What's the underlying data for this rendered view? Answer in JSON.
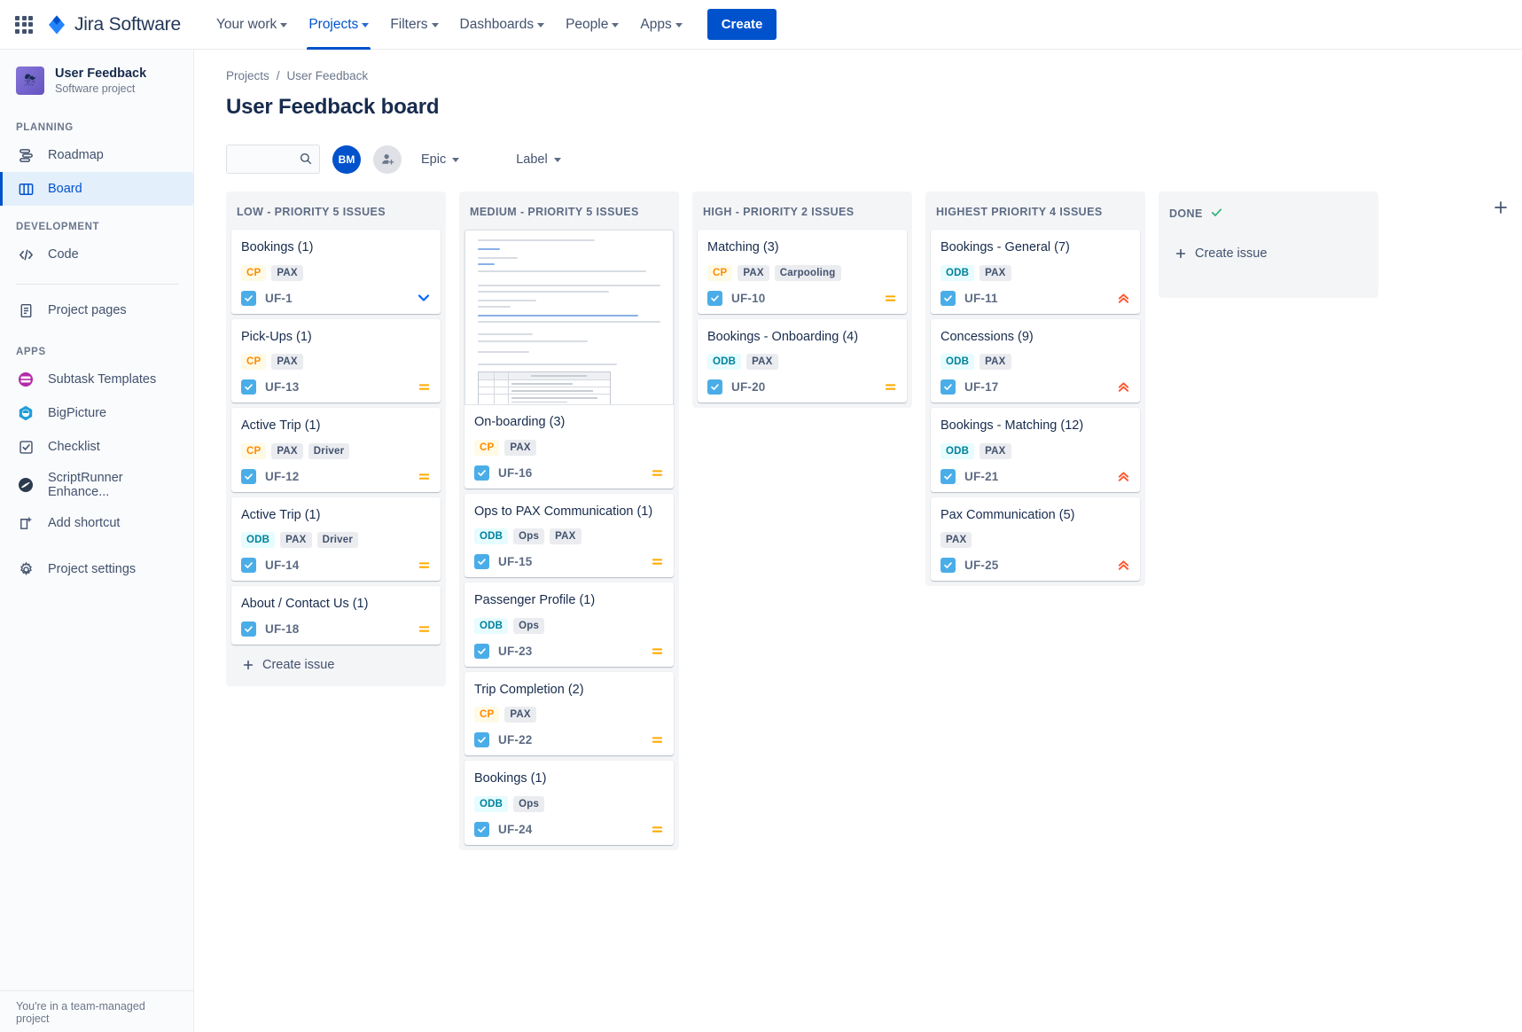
{
  "topnav": {
    "apps_icon": "apps-grid-icon",
    "brand": "Jira Software",
    "items": [
      {
        "label": "Your work",
        "active": false
      },
      {
        "label": "Projects",
        "active": true
      },
      {
        "label": "Filters",
        "active": false
      },
      {
        "label": "Dashboards",
        "active": false
      },
      {
        "label": "People",
        "active": false
      },
      {
        "label": "Apps",
        "active": false
      }
    ],
    "create_label": "Create"
  },
  "sidebar": {
    "project_name": "User Feedback",
    "project_type": "Software project",
    "sections": [
      {
        "label": "PLANNING",
        "items": [
          {
            "label": "Roadmap",
            "icon": "roadmap-icon",
            "selected": false
          },
          {
            "label": "Board",
            "icon": "board-icon",
            "selected": true
          }
        ]
      },
      {
        "label": "DEVELOPMENT",
        "items": [
          {
            "label": "Code",
            "icon": "code-icon",
            "selected": false
          }
        ]
      }
    ],
    "standalone": [
      {
        "label": "Project pages",
        "icon": "page-icon"
      }
    ],
    "apps_label": "APPS",
    "apps": [
      {
        "label": "Subtask Templates",
        "icon": "subtask-templates-icon",
        "color": "#b429a8"
      },
      {
        "label": "BigPicture",
        "icon": "bigpicture-icon",
        "color": "#1f9ed8"
      },
      {
        "label": "Checklist",
        "icon": "checklist-icon",
        "color": "#42526e"
      },
      {
        "label": "ScriptRunner Enhance...",
        "icon": "scriptrunner-icon",
        "color": "#2b3a4d"
      },
      {
        "label": "Add shortcut",
        "icon": "add-shortcut-icon",
        "color": "#42526e"
      }
    ],
    "settings": {
      "label": "Project settings",
      "icon": "gear-icon"
    },
    "footer_note": "You're in a team-managed project"
  },
  "breadcrumb": {
    "items": [
      "Projects",
      "User Feedback"
    ],
    "separator": "/"
  },
  "page_title": "User Feedback board",
  "toolbar": {
    "search_placeholder": "",
    "search_value": "",
    "search_icon": "search-icon",
    "avatar_initials": "BM",
    "add_people_icon": "add-person-icon",
    "filters": [
      {
        "label": "Epic"
      },
      {
        "label": "Label"
      }
    ]
  },
  "board": {
    "add_column_icon": "plus-icon",
    "create_issue_label": "Create issue",
    "columns": [
      {
        "name": "LOW - PRIORITY 5 ISSUES",
        "done": false,
        "show_create": true,
        "cards": [
          {
            "title": "Bookings (1)",
            "labels": [
              {
                "text": "CP",
                "style": "cp"
              },
              {
                "text": "PAX",
                "style": "plain"
              }
            ],
            "key": "UF-1",
            "priority": "chevron-down-blue"
          },
          {
            "title": "Pick-Ups (1)",
            "labels": [
              {
                "text": "CP",
                "style": "cp"
              },
              {
                "text": "PAX",
                "style": "plain"
              }
            ],
            "key": "UF-13",
            "priority": "medium"
          },
          {
            "title": "Active Trip (1)",
            "labels": [
              {
                "text": "CP",
                "style": "cp"
              },
              {
                "text": "PAX",
                "style": "plain"
              },
              {
                "text": "Driver",
                "style": "plain"
              }
            ],
            "key": "UF-12",
            "priority": "medium"
          },
          {
            "title": "Active Trip (1)",
            "labels": [
              {
                "text": "ODB",
                "style": "odb"
              },
              {
                "text": "PAX",
                "style": "plain"
              },
              {
                "text": "Driver",
                "style": "plain"
              }
            ],
            "key": "UF-14",
            "priority": "medium"
          },
          {
            "title": "About / Contact Us (1)",
            "labels": [],
            "key": "UF-18",
            "priority": "medium"
          }
        ]
      },
      {
        "name": "MEDIUM - PRIORITY 5 ISSUES",
        "done": false,
        "show_create": false,
        "cards": [
          {
            "title": "On-boarding (3)",
            "labels": [
              {
                "text": "CP",
                "style": "cp"
              },
              {
                "text": "PAX",
                "style": "plain"
              }
            ],
            "key": "UF-16",
            "priority": "medium",
            "attachment": "document-preview"
          },
          {
            "title": "Ops to PAX Communication (1)",
            "labels": [
              {
                "text": "ODB",
                "style": "odb"
              },
              {
                "text": "Ops",
                "style": "plain"
              },
              {
                "text": "PAX",
                "style": "plain"
              }
            ],
            "key": "UF-15",
            "priority": "medium"
          },
          {
            "title": "Passenger Profile (1)",
            "labels": [
              {
                "text": "ODB",
                "style": "odb"
              },
              {
                "text": "Ops",
                "style": "plain"
              }
            ],
            "key": "UF-23",
            "priority": "medium"
          },
          {
            "title": "Trip Completion (2)",
            "labels": [
              {
                "text": "CP",
                "style": "cp"
              },
              {
                "text": "PAX",
                "style": "plain"
              }
            ],
            "key": "UF-22",
            "priority": "medium"
          },
          {
            "title": "Bookings (1)",
            "labels": [
              {
                "text": "ODB",
                "style": "odb"
              },
              {
                "text": "Ops",
                "style": "plain"
              }
            ],
            "key": "UF-24",
            "priority": "medium"
          }
        ]
      },
      {
        "name": "HIGH - PRIORITY 2 ISSUES",
        "done": false,
        "show_create": false,
        "cards": [
          {
            "title": "Matching (3)",
            "labels": [
              {
                "text": "CP",
                "style": "cp"
              },
              {
                "text": "PAX",
                "style": "plain"
              },
              {
                "text": "Carpooling",
                "style": "plain"
              }
            ],
            "key": "UF-10",
            "priority": "medium"
          },
          {
            "title": "Bookings - Onboarding (4)",
            "labels": [
              {
                "text": "ODB",
                "style": "odb"
              },
              {
                "text": "PAX",
                "style": "plain"
              }
            ],
            "key": "UF-20",
            "priority": "medium"
          }
        ]
      },
      {
        "name": "HIGHEST PRIORITY 4 ISSUES",
        "done": false,
        "show_create": false,
        "cards": [
          {
            "title": "Bookings - General (7)",
            "labels": [
              {
                "text": "ODB",
                "style": "odb"
              },
              {
                "text": "PAX",
                "style": "plain"
              }
            ],
            "key": "UF-11",
            "priority": "highest"
          },
          {
            "title": "Concessions (9)",
            "labels": [
              {
                "text": "ODB",
                "style": "odb"
              },
              {
                "text": "PAX",
                "style": "plain"
              }
            ],
            "key": "UF-17",
            "priority": "highest"
          },
          {
            "title": "Bookings - Matching (12)",
            "labels": [
              {
                "text": "ODB",
                "style": "odb"
              },
              {
                "text": "PAX",
                "style": "plain"
              }
            ],
            "key": "UF-21",
            "priority": "highest"
          },
          {
            "title": "Pax Communication (5)",
            "labels": [
              {
                "text": "PAX",
                "style": "plain"
              }
            ],
            "key": "UF-25",
            "priority": "highest"
          }
        ]
      },
      {
        "name": "DONE",
        "done": true,
        "show_create": true,
        "cards": []
      }
    ]
  }
}
